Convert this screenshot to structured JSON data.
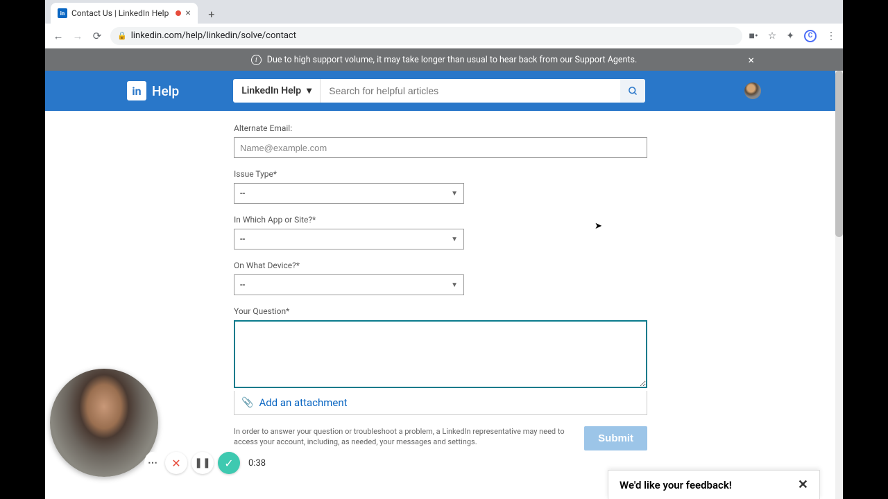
{
  "browser": {
    "tab_title": "Contact Us | LinkedIn Help",
    "url": "linkedin.com/help/linkedin/solve/contact"
  },
  "banner": {
    "text": "Due to high support volume, it may take longer than usual to hear back from our Support Agents."
  },
  "header": {
    "logo_text": "in",
    "help_label": "Help",
    "dropdown_label": "LinkedIn Help",
    "search_placeholder": "Search for helpful articles"
  },
  "form": {
    "alt_email": {
      "label": "Alternate Email:",
      "placeholder": "Name@example.com"
    },
    "issue_type": {
      "label": "Issue Type",
      "value": "--"
    },
    "app_site": {
      "label": "In Which App or Site?",
      "value": "--"
    },
    "device": {
      "label": "On What Device?",
      "value": "--"
    },
    "question": {
      "label": "Your Question"
    },
    "attach_label": "Add an attachment",
    "disclaimer": "In order to answer your question or troubleshoot a problem, a LinkedIn representative may need to access your account, including, as needed, your messages and settings.",
    "submit_label": "Submit"
  },
  "recorder": {
    "time": "0:38"
  },
  "feedback": {
    "text": "We'd like your feedback!"
  }
}
